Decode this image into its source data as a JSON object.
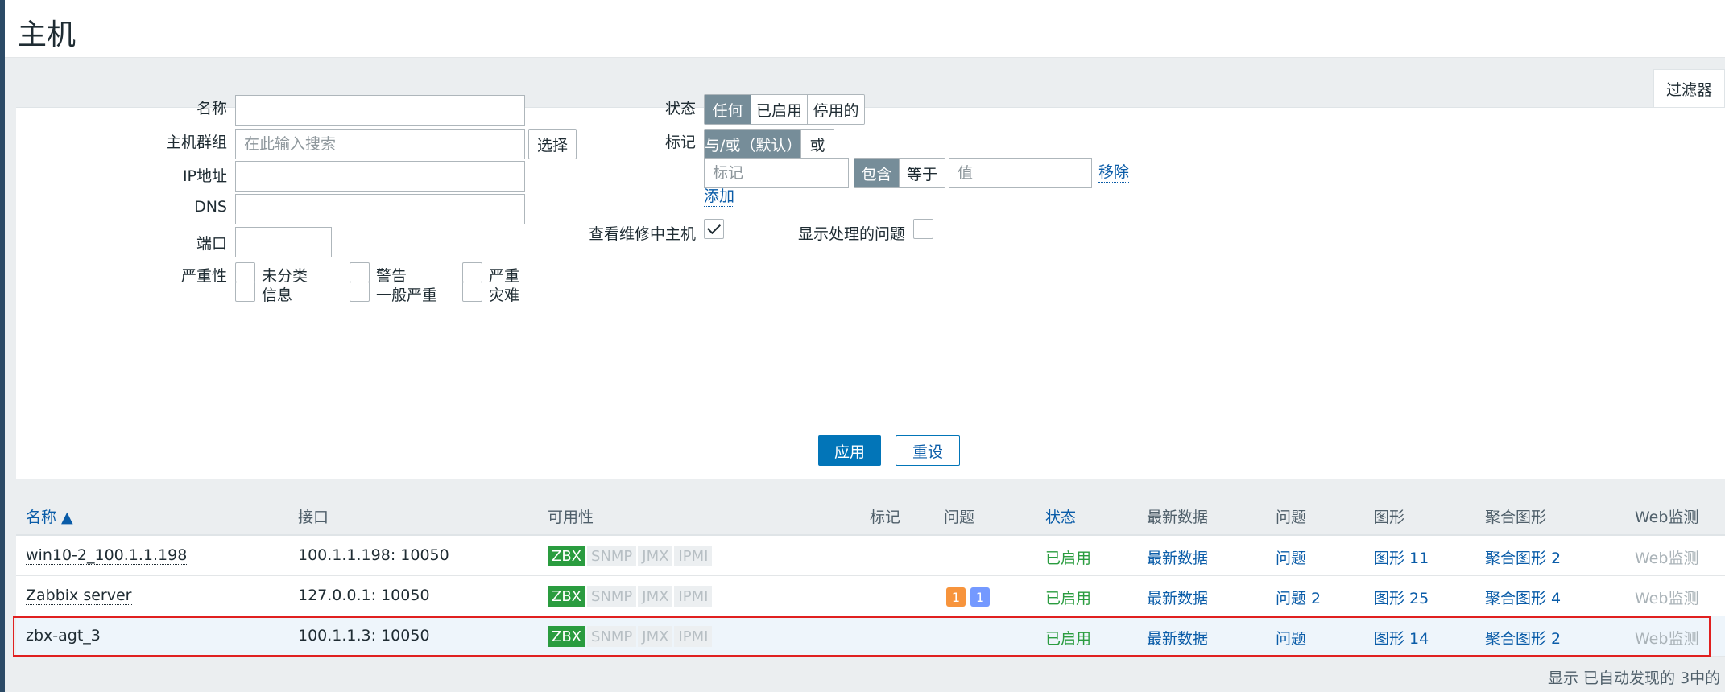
{
  "page": {
    "title": "主机",
    "filter_tab": "过滤器"
  },
  "filter": {
    "name_label": "名称",
    "name_value": "",
    "hostgroup_label": "主机群组",
    "hostgroup_placeholder": "在此输入搜索",
    "select_button": "选择",
    "ip_label": "IP地址",
    "dns_label": "DNS",
    "port_label": "端口",
    "severity_label": "严重性",
    "severity_options": [
      "未分类",
      "警告",
      "严重",
      "信息",
      "一般严重",
      "灾难"
    ],
    "status_label": "状态",
    "status_options": [
      "任何",
      "已启用",
      "停用的"
    ],
    "status_selected": "任何",
    "tags_label": "标记",
    "tags_mode_options": [
      "与/或（默认）",
      "或"
    ],
    "tag_placeholder": "标记",
    "tag_operator_options": [
      "包含",
      "等于"
    ],
    "value_placeholder": "值",
    "remove_link": "移除",
    "add_link": "添加",
    "maintenance_label": "查看维修中主机",
    "maintenance_checked": true,
    "suppressed_label": "显示处理的问题",
    "suppressed_checked": false,
    "apply_button": "应用",
    "reset_button": "重设"
  },
  "table": {
    "columns": [
      "名称 ▲",
      "接口",
      "可用性",
      "标记",
      "问题",
      "状态",
      "最新数据",
      "问题",
      "图形",
      "聚合图形",
      "Web监测"
    ],
    "availability_labels": [
      "ZBX",
      "SNMP",
      "JMX",
      "IPMI"
    ],
    "rows": [
      {
        "name": "win10-2_100.1.1.198",
        "interface": "100.1.1.198: 10050",
        "status": "已启用",
        "latest": "最新数据",
        "problems": "问题",
        "graphs": "图形 11",
        "screens": "聚合图形 2",
        "web": "Web监测"
      },
      {
        "name": "Zabbix server",
        "interface": "127.0.0.1: 10050",
        "badge_warning": "1",
        "badge_info": "1",
        "status": "已启用",
        "latest": "最新数据",
        "problems": "问题 2",
        "graphs": "图形 25",
        "screens": "聚合图形 4",
        "web": "Web监测"
      },
      {
        "name": "zbx-agt_3",
        "interface": "100.1.1.3: 10050",
        "status": "已启用",
        "latest": "最新数据",
        "problems": "问题",
        "graphs": "图形 14",
        "screens": "聚合图形 2",
        "web": "Web监测"
      }
    ]
  },
  "footer": {
    "note": "显示 已自动发现的 3中的"
  },
  "colors": {
    "accent": "#0275b8",
    "enabled": "#2a9c3f",
    "badge_warning": "#f7943c",
    "badge_info": "#7499ff",
    "highlight": "#e02020"
  }
}
